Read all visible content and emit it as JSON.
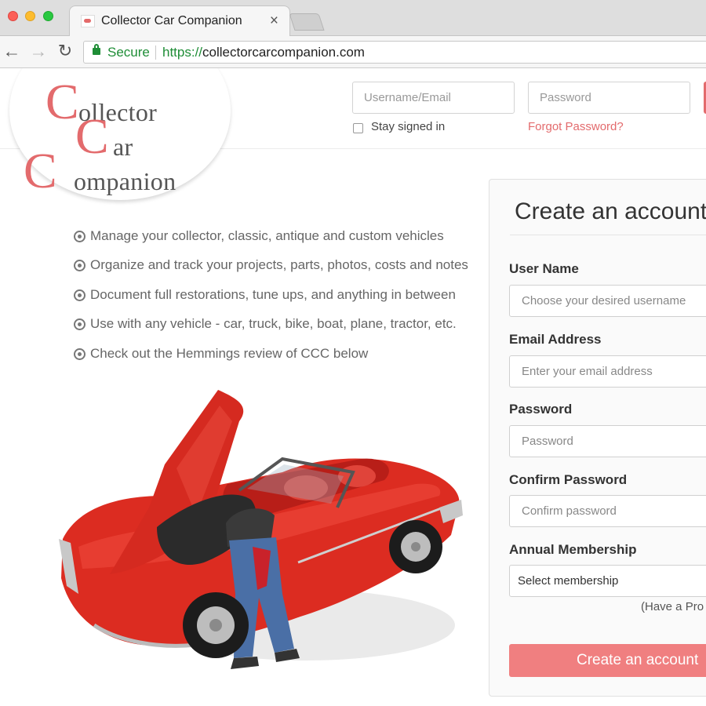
{
  "browser": {
    "tab_title": "Collector Car Companion",
    "tab_close": "×",
    "secure_label": "Secure",
    "url_scheme": "https://",
    "url_host": "collectorcarcompanion.com"
  },
  "logo": {
    "line1_cap": "C",
    "line1_rest": "ollector",
    "line2_cap": "C",
    "line2_rest": "ar",
    "line3_cap": "C",
    "line3_rest": "ompanion"
  },
  "login": {
    "username_placeholder": "Username/Email",
    "password_placeholder": "Password",
    "stay_signed_in": "Stay signed in",
    "forgot_password": "Forgot Password?"
  },
  "features": [
    "Manage your collector, classic, antique and custom vehicles",
    "Organize and track your projects, parts, photos, costs and notes",
    "Document full restorations, tune ups, and anything in between",
    "Use with any vehicle - car, truck, bike, boat, plane, tractor, etc.",
    "Check out the Hemmings review of CCC below"
  ],
  "signup": {
    "title": "Create an account",
    "username_label": "User Name",
    "username_placeholder": "Choose your desired username",
    "email_label": "Email Address",
    "email_placeholder": "Enter your email address",
    "password_label": "Password",
    "password_placeholder": "Password",
    "confirm_label": "Confirm Password",
    "confirm_placeholder": "Confirm password",
    "membership_label": "Annual Membership",
    "membership_selected": "Select membership",
    "promo_note": "(Have a Pro",
    "submit_label": "Create an account"
  },
  "colors": {
    "brand_red": "#e36b6d",
    "button_red": "#f07f80",
    "secure_green": "#1e8d36"
  }
}
